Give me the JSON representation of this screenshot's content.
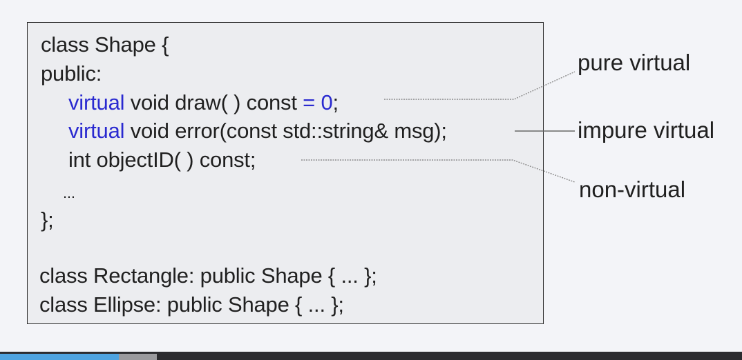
{
  "code": {
    "line1": "class Shape {",
    "line2": "public:",
    "line3_kw": "virtual",
    "line3_rest": " void draw( ) const ",
    "line3_assign": "= 0",
    "line3_end": ";",
    "line4_kw": "virtual",
    "line4_rest": " void error(const std::string& msg);",
    "line5": "int objectID( ) const;",
    "line6": "...",
    "line7": "};",
    "line8": "class Rectangle: public Shape { ... };",
    "line9": "class Ellipse: public Shape { ... };"
  },
  "annotations": {
    "pure": "pure virtual",
    "impure": "impure virtual",
    "non": "non-virtual"
  },
  "colors": {
    "keyword": "#2a2ad0",
    "progress": "#4ea3e0"
  },
  "player": {
    "progress_fraction": 0.16
  }
}
